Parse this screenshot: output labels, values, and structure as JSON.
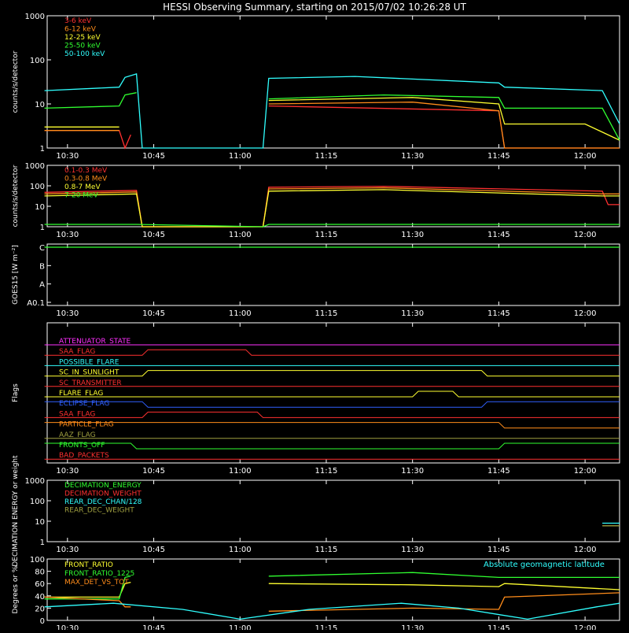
{
  "title": "HESSI Observing Summary, starting on 2015/07/02 10:26:28 UT",
  "time_ticks": [
    "10:30",
    "10:45",
    "11:00",
    "11:15",
    "11:30",
    "11:45",
    "12:00"
  ],
  "colors": {
    "red": "#ff3030",
    "orange": "#ff8c1a",
    "yellow": "#ffff30",
    "green": "#30ff30",
    "cyan": "#30ffff",
    "blue": "#3060ff",
    "magenta": "#ff30ff",
    "olive": "#a0a040",
    "white": "#ffffff"
  },
  "chart_data": [
    {
      "type": "line",
      "panel": "hxr",
      "ylabel": "counts/s/detector",
      "yscale": "log",
      "ylim": [
        1,
        1000
      ],
      "yticks": [
        "1",
        "10",
        "100",
        "1000"
      ],
      "legend_position": "top-left",
      "series": [
        {
          "name": "3-6 keV",
          "color": "#ff3030",
          "x": [
            "10:26",
            "10:39",
            "10:40",
            "10:41",
            "11:04",
            "11:05",
            "11:45",
            "11:46",
            "12:06"
          ],
          "y": [
            2.5,
            2.5,
            1,
            2,
            null,
            9,
            7,
            1,
            1
          ]
        },
        {
          "name": "6-12 keV",
          "color": "#ff8c1a",
          "x": [
            "10:26",
            "10:39",
            "11:04",
            "11:05",
            "11:30",
            "11:45",
            "11:46",
            "12:06"
          ],
          "y": [
            2.5,
            2.5,
            null,
            10,
            11,
            7,
            1,
            1
          ]
        },
        {
          "name": "12-25 keV",
          "color": "#ffff30",
          "x": [
            "10:26",
            "10:39",
            "11:04",
            "11:05",
            "11:30",
            "11:45",
            "11:46",
            "12:00",
            "12:06"
          ],
          "y": [
            3,
            3,
            null,
            12,
            14,
            10,
            3.5,
            3.5,
            1.5
          ]
        },
        {
          "name": "25-50 keV",
          "color": "#30ff30",
          "x": [
            "10:26",
            "10:39",
            "10:40",
            "10:42",
            "11:04",
            "11:05",
            "11:25",
            "11:45",
            "11:46",
            "12:03",
            "12:06"
          ],
          "y": [
            8,
            9,
            16,
            18,
            null,
            13,
            16,
            14,
            8,
            8,
            1.5
          ]
        },
        {
          "name": "50-100 keV",
          "color": "#30ffff",
          "x": [
            "10:26",
            "10:39",
            "10:40",
            "10:42",
            "10:43",
            "11:04",
            "11:05",
            "11:20",
            "11:45",
            "11:46",
            "12:03",
            "12:06"
          ],
          "y": [
            20,
            24,
            40,
            48,
            1,
            1,
            38,
            42,
            30,
            24,
            20,
            3.5
          ]
        }
      ]
    },
    {
      "type": "line",
      "panel": "gamma",
      "ylabel": "counts/s/detector",
      "yscale": "log",
      "ylim": [
        1,
        1000
      ],
      "yticks": [
        "1",
        "10",
        "100",
        "1000"
      ],
      "legend_position": "top-left",
      "series": [
        {
          "name": "0.1-0.3 MeV",
          "color": "#ff3030",
          "x": [
            "10:26",
            "10:42",
            "10:43",
            "11:04",
            "11:05",
            "11:25",
            "12:03",
            "12:04",
            "12:06"
          ],
          "y": [
            48,
            60,
            1,
            1,
            85,
            95,
            55,
            12,
            12
          ]
        },
        {
          "name": "0.3-0.8 MeV",
          "color": "#ff8c1a",
          "x": [
            "10:26",
            "10:42",
            "10:43",
            "11:04",
            "11:05",
            "11:25",
            "12:03",
            "12:06"
          ],
          "y": [
            40,
            50,
            1,
            1,
            70,
            80,
            40,
            40
          ]
        },
        {
          "name": "0.8-7 MeV",
          "color": "#ffff30",
          "x": [
            "10:26",
            "10:42",
            "10:43",
            "11:04",
            "11:05",
            "11:25",
            "12:03",
            "12:06"
          ],
          "y": [
            32,
            40,
            1,
            1,
            55,
            65,
            32,
            32
          ]
        },
        {
          "name": "7-20 MeV",
          "color": "#30ff30",
          "x": [
            "10:26",
            "10:42",
            "11:04",
            "11:05",
            "12:06"
          ],
          "y": [
            1.3,
            1.3,
            1,
            1.3,
            1.3
          ]
        }
      ]
    },
    {
      "type": "line",
      "panel": "goes",
      "ylabel": "GOES15 [W m⁻²]",
      "ylim": [
        "A0.1",
        "C"
      ],
      "yticks": [
        "A0.1",
        "A",
        "B",
        "C"
      ],
      "series": [
        {
          "name": "",
          "color": "#30ff30",
          "x": [
            "10:26",
            "10:50",
            "11:05",
            "11:30",
            "12:06"
          ],
          "y": [
            "C",
            "C",
            "C",
            "C",
            "C"
          ]
        }
      ]
    },
    {
      "type": "line",
      "panel": "flags",
      "ylabel": "Flags",
      "series": [
        {
          "name": "ATTENUATOR_STATE",
          "color": "#ff30ff",
          "x": [
            "10:26",
            "12:06"
          ],
          "y": [
            0,
            0
          ]
        },
        {
          "name": "SAA_FLAG",
          "color": "#ff3030",
          "x": [
            "10:26",
            "10:43",
            "10:44",
            "11:01",
            "11:02",
            "12:06"
          ],
          "y": [
            0,
            0,
            1,
            1,
            0,
            0
          ]
        },
        {
          "name": "POSSIBLE_FLARE",
          "color": "#30ffff",
          "x": [
            "10:26",
            "12:06"
          ],
          "y": [
            0,
            0
          ]
        },
        {
          "name": "SC_IN_SUNLIGHT",
          "color": "#ffff30",
          "x": [
            "10:26",
            "10:43",
            "10:44",
            "11:42",
            "11:43",
            "12:06"
          ],
          "y": [
            0,
            0,
            1,
            1,
            0,
            0
          ]
        },
        {
          "name": "SC_TRANSMITTER",
          "color": "#ff3030",
          "x": [
            "10:26",
            "12:06"
          ],
          "y": [
            0,
            0
          ]
        },
        {
          "name": "FLARE_FLAG",
          "color": "#ffff30",
          "x": [
            "10:26",
            "11:30",
            "11:31",
            "11:37",
            "11:38",
            "12:06"
          ],
          "y": [
            0,
            0,
            1,
            1,
            0,
            0
          ]
        },
        {
          "name": "ECLIPSE_FLAG",
          "color": "#3060ff",
          "x": [
            "10:26",
            "10:43",
            "10:44",
            "11:42",
            "11:43",
            "12:06"
          ],
          "y": [
            1,
            1,
            0,
            0,
            1,
            1
          ]
        },
        {
          "name": "SAA_FLAG",
          "color": "#ff3030",
          "x": [
            "10:26",
            "10:43",
            "10:44",
            "11:03",
            "11:04",
            "12:06"
          ],
          "y": [
            0,
            0,
            1,
            1,
            0,
            0
          ]
        },
        {
          "name": "PARTICLE_FLAG",
          "color": "#ff8c1a",
          "x": [
            "10:26",
            "11:45",
            "11:46",
            "12:06"
          ],
          "y": [
            1,
            1,
            0,
            0
          ]
        },
        {
          "name": "AAZ_FLAG",
          "color": "#a0a040",
          "x": [
            "10:26",
            "12:06"
          ],
          "y": [
            0,
            0
          ]
        },
        {
          "name": "FRONTS_OFF",
          "color": "#30ff30",
          "x": [
            "10:26",
            "10:41",
            "10:42",
            "11:45",
            "11:46",
            "12:06"
          ],
          "y": [
            1,
            1,
            0,
            0,
            1,
            1
          ]
        },
        {
          "name": "BAD_PACKETS",
          "color": "#ff3030",
          "x": [
            "10:26",
            "12:06"
          ],
          "y": [
            0,
            0
          ]
        }
      ]
    },
    {
      "type": "line",
      "panel": "decimation",
      "ylabel": "DECIMATION ENERGY or weight",
      "yscale": "log",
      "ylim": [
        1,
        1000
      ],
      "yticks": [
        "1",
        "10",
        "100",
        "1000"
      ],
      "legend_position": "top-left",
      "series": [
        {
          "name": "DECIMATION_ENERGY",
          "color": "#30ff30",
          "x": [],
          "y": []
        },
        {
          "name": "DECIMATION_WEIGHT",
          "color": "#ff3030",
          "x": [],
          "y": []
        },
        {
          "name": "REAR_DEC_CHAN/128",
          "color": "#30ffff",
          "x": [
            "12:03",
            "12:06"
          ],
          "y": [
            8,
            8
          ]
        },
        {
          "name": "REAR_DEC_WEIGHT",
          "color": "#a0a040",
          "x": [
            "12:03",
            "12:06"
          ],
          "y": [
            6,
            6
          ]
        }
      ]
    },
    {
      "type": "line",
      "panel": "ratio",
      "ylabel": "Degrees or %",
      "ylim": [
        0,
        100
      ],
      "yticks": [
        "0",
        "20",
        "40",
        "60",
        "80",
        "100"
      ],
      "legend_position": "top-left",
      "series": [
        {
          "name": "FRONT_RATIO",
          "color": "#ffff30",
          "x": [
            "10:26",
            "10:39",
            "10:40",
            "10:41",
            "11:04",
            "11:05",
            "11:30",
            "11:45",
            "11:46",
            "12:06"
          ],
          "y": [
            38,
            38,
            60,
            62,
            null,
            60,
            58,
            55,
            60,
            50
          ]
        },
        {
          "name": "FRONT_RATIO_1225",
          "color": "#30ff30",
          "x": [
            "10:26",
            "10:39",
            "10:40",
            "10:41",
            "11:04",
            "11:05",
            "11:30",
            "11:45",
            "11:46",
            "12:06"
          ],
          "y": [
            35,
            35,
            70,
            72,
            null,
            72,
            78,
            70,
            70,
            70
          ]
        },
        {
          "name": "MAX_DET_VS_TOT",
          "color": "#ff8c1a",
          "x": [
            "10:26",
            "10:39",
            "10:40",
            "10:41",
            "11:04",
            "11:05",
            "11:30",
            "11:45",
            "11:46",
            "12:06"
          ],
          "y": [
            38,
            32,
            22,
            22,
            null,
            15,
            20,
            18,
            38,
            45
          ]
        },
        {
          "name": "Absolute geomagnetic latitude",
          "color": "#30ffff",
          "x": [
            "10:26",
            "10:38",
            "10:50",
            "11:00",
            "11:12",
            "11:28",
            "11:38",
            "11:50",
            "12:02",
            "12:06"
          ],
          "y": [
            22,
            28,
            18,
            2,
            18,
            28,
            20,
            2,
            22,
            28
          ]
        }
      ]
    }
  ]
}
